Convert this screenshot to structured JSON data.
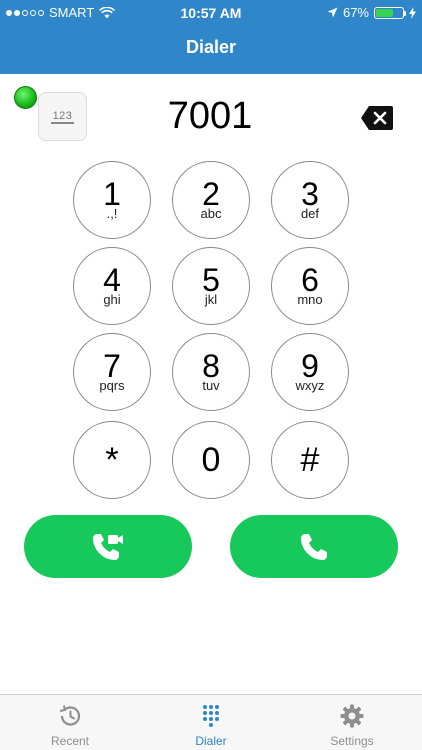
{
  "status_bar": {
    "carrier": "SMART",
    "time": "10:57 AM",
    "battery_percent": "67%",
    "battery_level": 0.67
  },
  "nav": {
    "title": "Dialer"
  },
  "keyboard_toggle": {
    "label": "123"
  },
  "dialed_number": "7001",
  "keypad": [
    {
      "digit": "1",
      "letters": ".,!"
    },
    {
      "digit": "2",
      "letters": "abc"
    },
    {
      "digit": "3",
      "letters": "def"
    },
    {
      "digit": "4",
      "letters": "ghi"
    },
    {
      "digit": "5",
      "letters": "jkl"
    },
    {
      "digit": "6",
      "letters": "mno"
    },
    {
      "digit": "7",
      "letters": "pqrs"
    },
    {
      "digit": "8",
      "letters": "tuv"
    },
    {
      "digit": "9",
      "letters": "wxyz"
    },
    {
      "digit": "*",
      "letters": ""
    },
    {
      "digit": "0",
      "letters": ""
    },
    {
      "digit": "#",
      "letters": ""
    }
  ],
  "tabs": [
    {
      "label": "Recent",
      "icon": "history-icon"
    },
    {
      "label": "Dialer",
      "icon": "keypad-icon",
      "active": true
    },
    {
      "label": "Settings",
      "icon": "gear-icon"
    }
  ],
  "colors": {
    "header": "#2f86c8",
    "call_green": "#16c95a",
    "tab_active": "#2f86c8"
  }
}
